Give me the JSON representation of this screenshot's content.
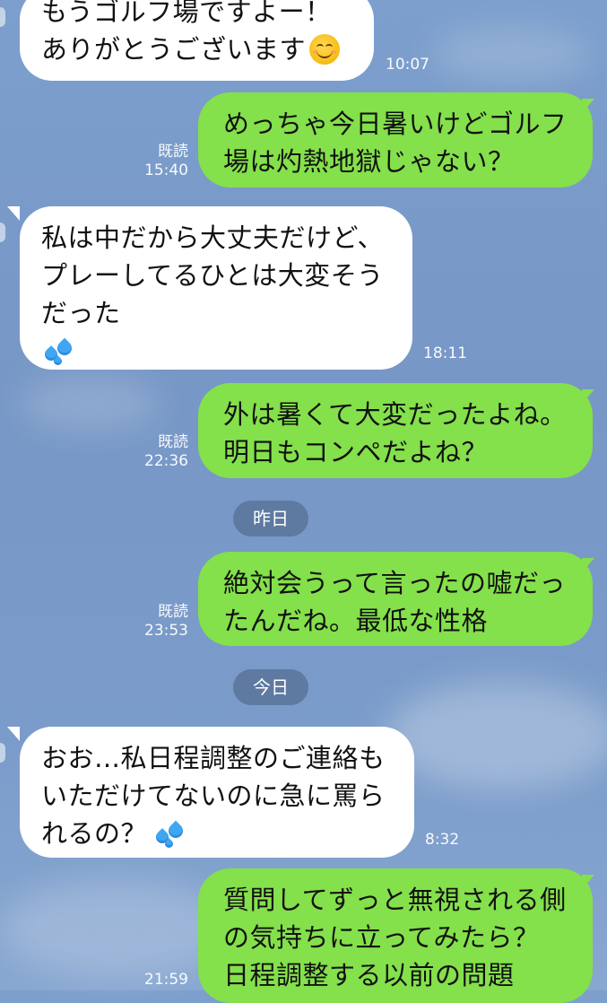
{
  "messages": [
    {
      "id": "m1",
      "side": "in",
      "text": "もうゴルフ場ですよー！\nありがとうございます",
      "emoji": "smiling-face-icon",
      "time": "10:07"
    },
    {
      "id": "m2",
      "side": "out",
      "text": "めっちゃ今日暑いけどゴルフ\n場は灼熱地獄じゃない？",
      "read": "既読",
      "time": "15:40"
    },
    {
      "id": "m3",
      "side": "in",
      "text": "私は中だから大丈夫だけど、\nプレーしてるひとは大変そう\nだった",
      "emoji": "sweat-droplets-icon",
      "time": "18:11"
    },
    {
      "id": "m4",
      "side": "out",
      "text": "外は暑くて大変だったよね。\n明日もコンペだよね？",
      "read": "既読",
      "time": "22:36"
    },
    {
      "id": "m5",
      "side": "out",
      "text": "絶対会うって言ったの嘘だっ\nたんだね。最低な性格",
      "read": "既読",
      "time": "23:53"
    },
    {
      "id": "m6",
      "side": "in",
      "text": "おお…私日程調整のご連絡も\nいただけてないのに急に罵ら\nれるの？",
      "emoji": "sweat-droplets-icon",
      "time": "8:32"
    },
    {
      "id": "m7",
      "side": "out",
      "text": "質問してずっと無視される側\nの気持ちに立ってみたら？\n日程調整する以前の問題",
      "time": "21:59"
    }
  ],
  "date_dividers": {
    "yesterday": "昨日",
    "today": "今日"
  },
  "colors": {
    "background": "#7c9fcd",
    "incoming_bubble": "#ffffff",
    "outgoing_bubble": "#84e04b",
    "date_pill": "#5f7aa1",
    "meta_text": "#ffffff"
  }
}
